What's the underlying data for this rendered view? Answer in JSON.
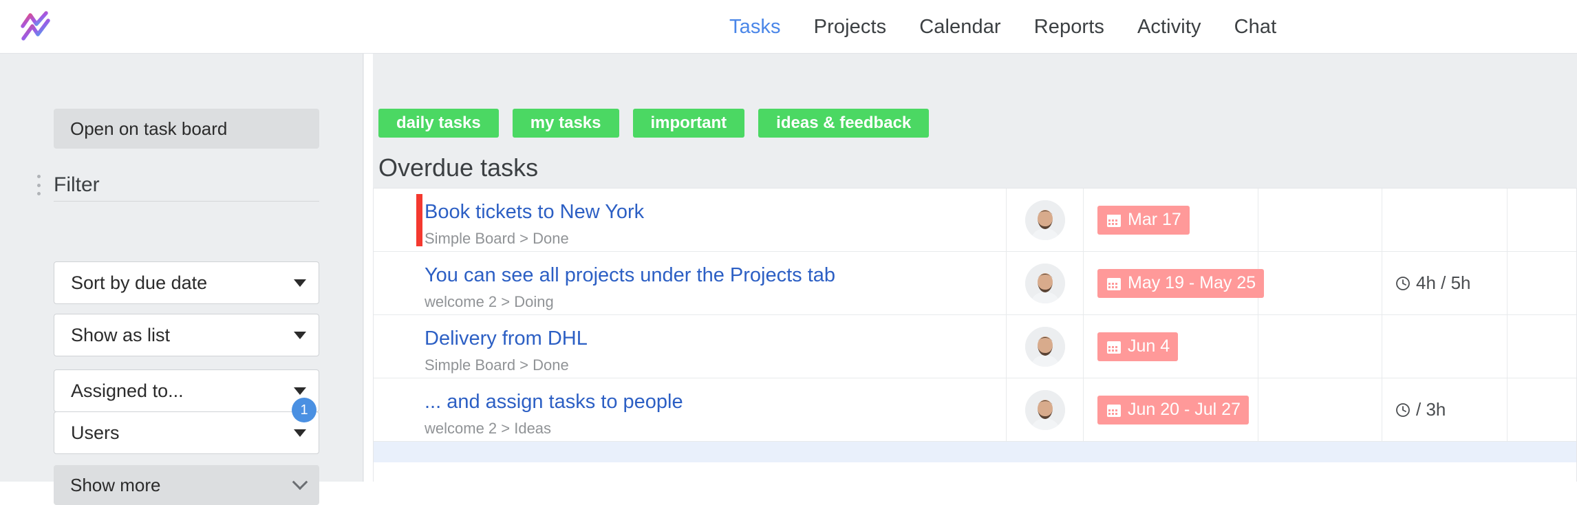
{
  "brand": {
    "logo_icon": "zigzag-logo-icon"
  },
  "nav": {
    "items": [
      {
        "label": "Tasks",
        "active": true
      },
      {
        "label": "Projects",
        "active": false
      },
      {
        "label": "Calendar",
        "active": false
      },
      {
        "label": "Reports",
        "active": false
      },
      {
        "label": "Activity",
        "active": false
      },
      {
        "label": "Chat",
        "active": false
      }
    ],
    "active_color": "#4a86e8",
    "text_color": "#3c4043"
  },
  "sidebar": {
    "open_board_label": "Open on task board",
    "filter_label": "Filter",
    "grip_icon": "drag-handle-icon",
    "selects": [
      {
        "value": "Sort by due date"
      },
      {
        "value": "Show as list"
      },
      {
        "value": "Assigned to..."
      },
      {
        "value": "Users"
      }
    ],
    "users_badge": "1",
    "badge_color": "#4a90e2",
    "show_more_label": "Show more",
    "chevron_icon": "chevron-down-icon"
  },
  "main": {
    "tags": [
      {
        "label": "daily tasks"
      },
      {
        "label": "my tasks"
      },
      {
        "label": "important"
      },
      {
        "label": "ideas & feedback"
      }
    ],
    "tag_color": "#4bd863",
    "section_title": "Overdue tasks",
    "date_chip_color": "#ff9999",
    "accent_color": "#f4392f",
    "link_color": "#2c5fc4",
    "calendar_icon": "calendar-icon",
    "clock_icon": "clock-icon",
    "avatar_icon": "user-avatar",
    "rows": [
      {
        "name": "Book tickets to New York",
        "path": "Simple Board > Done",
        "overdue": true,
        "date": "Mar 17",
        "time": ""
      },
      {
        "name": "You can see all projects under the Projects tab",
        "path": "welcome 2 > Doing",
        "overdue": false,
        "date": "May 19 - May 25",
        "time": "4h / 5h"
      },
      {
        "name": "Delivery from DHL",
        "path": "Simple Board > Done",
        "overdue": false,
        "date": "Jun 4",
        "time": ""
      },
      {
        "name": "... and assign tasks to people",
        "path": "welcome 2 > Ideas",
        "overdue": false,
        "date": "Jun 20 - Jul 27",
        "time": "/ 3h"
      }
    ]
  }
}
